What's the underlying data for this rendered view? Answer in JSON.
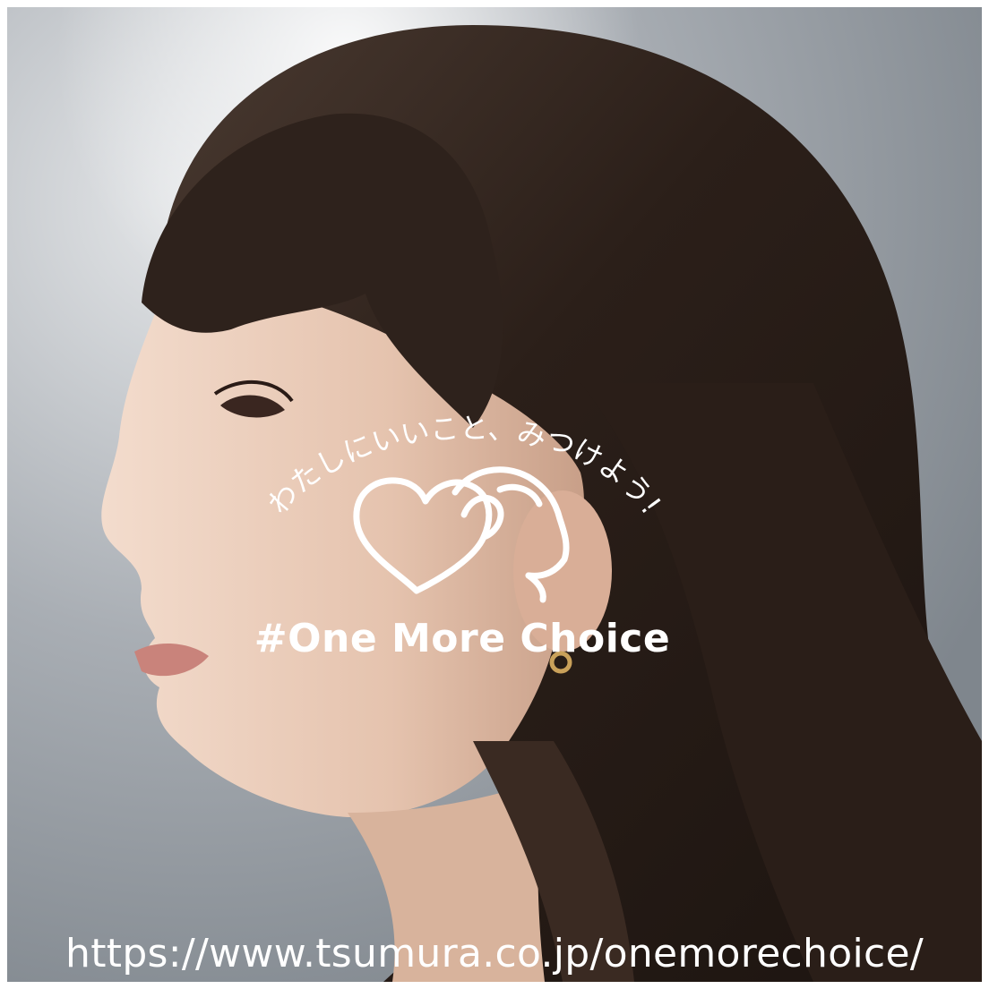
{
  "campaign": {
    "tagline": "わたしにいいこと、みつけよう!",
    "hashtag": "#One More Choice",
    "url": "https://www.tsumura.co.jp/onemorechoice/"
  },
  "icons": {
    "logo": "heart-hand-icon"
  },
  "colors": {
    "overlay_text": "#ffffff",
    "hair": "#2b1f19",
    "skin": "#e9c9b6",
    "background": "#b9bec4"
  }
}
